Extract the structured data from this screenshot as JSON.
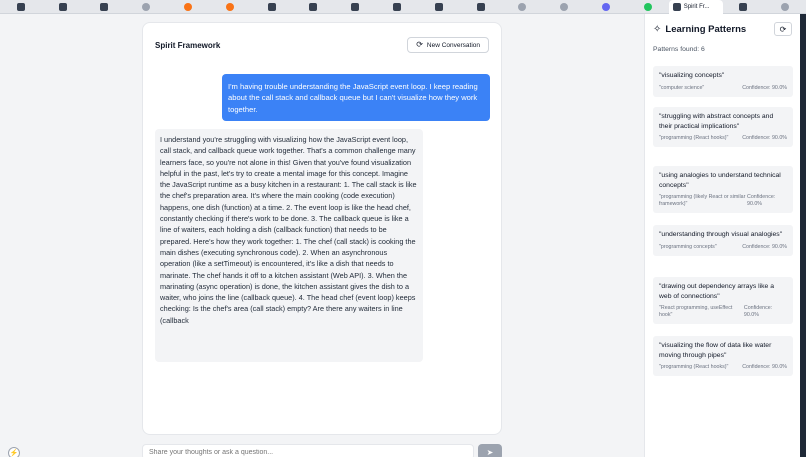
{
  "browser": {
    "active_tab_label": "Spirit Fr...",
    "tabs": [
      "app-icon",
      "app-icon",
      "app-icon",
      "app-icon",
      "app-icon",
      "app-icon",
      "app-icon",
      "app-icon",
      "app-icon",
      "app-icon",
      "app-icon",
      "app-icon",
      "app-icon",
      "app-icon",
      "app-icon",
      "app-icon"
    ]
  },
  "chat": {
    "title": "Spirit Framework",
    "new_conversation_label": "New Conversation",
    "user_message": "I'm having trouble understanding the JavaScript event loop. I keep reading about the call stack and callback queue but I can't visualize how they work together.",
    "assistant_message": "I understand you're struggling with visualizing how the JavaScript event loop, call stack, and callback queue work together. That's a common challenge many learners face, so you're not alone in this! Given that you've found visualization helpful in the past, let's try to create a mental image for this concept. Imagine the JavaScript runtime as a busy kitchen in a restaurant: 1. The call stack is like the chef's preparation area. It's where the main cooking (code execution) happens, one dish (function) at a time. 2. The event loop is like the head chef, constantly checking if there's work to be done. 3. The callback queue is like a line of waiters, each holding a dish (callback function) that needs to be prepared. Here's how they work together: 1. The chef (call stack) is cooking the main dishes (executing synchronous code). 2. When an asynchronous operation (like a setTimeout) is encountered, it's like a dish that needs to marinate. The chef hands it off to a kitchen assistant (Web API). 3. When the marinating (async operation) is done, the kitchen assistant gives the dish to a waiter, who joins the line (callback queue). 4. The head chef (event loop) keeps checking: Is the chef's area (call stack) empty? Are there any waiters in line (callback",
    "input_placeholder": "Share your thoughts or ask a question..."
  },
  "sidebar": {
    "title": "Learning Patterns",
    "count_label": "Patterns found: 6",
    "patterns": [
      {
        "title": "\"visualizing concepts\"",
        "category": "\"computer science\"",
        "confidence": "Confidence: 90.0%"
      },
      {
        "title": "\"struggling with abstract concepts and their practical implications\"",
        "category": "\"programming (React hooks)\"",
        "confidence": "Confidence: 90.0%"
      },
      {
        "title": "\"using analogies to understand technical concepts\"",
        "category": "\"programming (likely React or similar framework)\"",
        "confidence": "Confidence: 90.0%"
      },
      {
        "title": "\"understanding through visual analogies\"",
        "category": "\"programming concepts\"",
        "confidence": "Confidence: 90.0%"
      },
      {
        "title": "\"drawing out dependency arrays like a web of connections\"",
        "category": "\"React programming, useEffect hook\"",
        "confidence": "Confidence: 90.0%"
      },
      {
        "title": "\"visualizing the flow of data like water moving through pipes\"",
        "category": "\"programming (React hooks)\"",
        "confidence": "Confidence: 90.0%"
      }
    ]
  },
  "colors": {
    "accent": "#3b82f6",
    "assistant_bubble": "#f3f4f6",
    "card_bg": "#f3f4f6"
  }
}
